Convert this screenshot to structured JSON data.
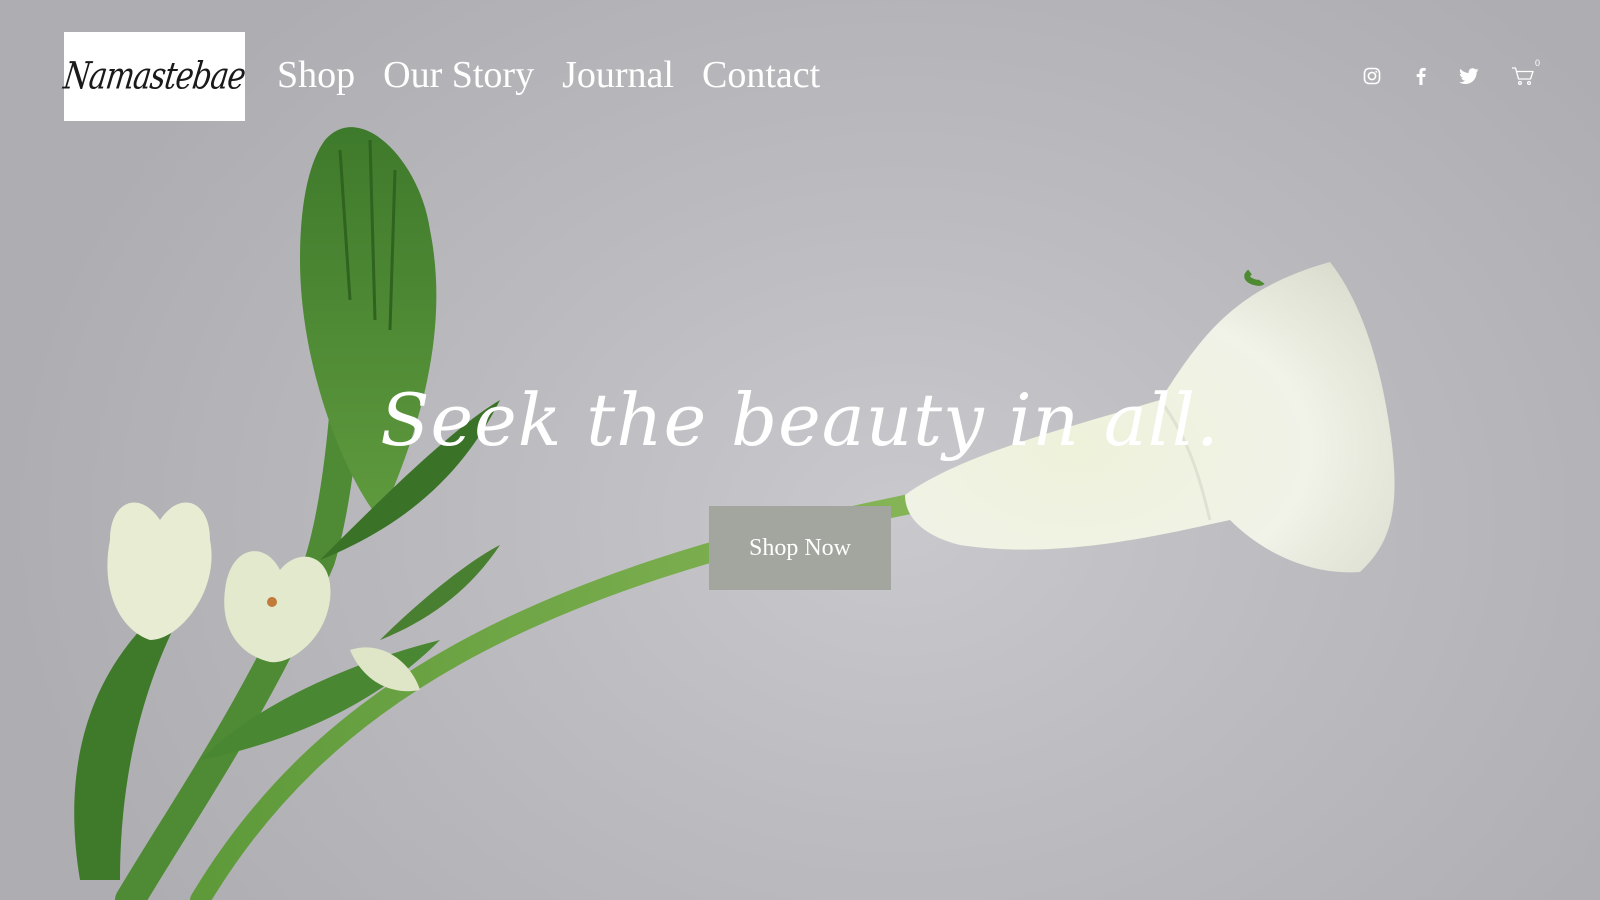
{
  "brand": {
    "logo_text": "Namastebae"
  },
  "nav": {
    "items": [
      {
        "label": "Shop"
      },
      {
        "label": "Our Story"
      },
      {
        "label": "Journal"
      },
      {
        "label": "Contact"
      }
    ]
  },
  "header_icons": {
    "instagram": "instagram-icon",
    "facebook": "facebook-icon",
    "twitter": "twitter-icon",
    "cart": "cart-icon",
    "cart_count": "0"
  },
  "hero": {
    "headline": "Seek the beauty in all.",
    "cta_label": "Shop Now",
    "cta_color": "#a3a69e",
    "background_color": "#c3c3c7",
    "text_color": "#ffffff"
  }
}
